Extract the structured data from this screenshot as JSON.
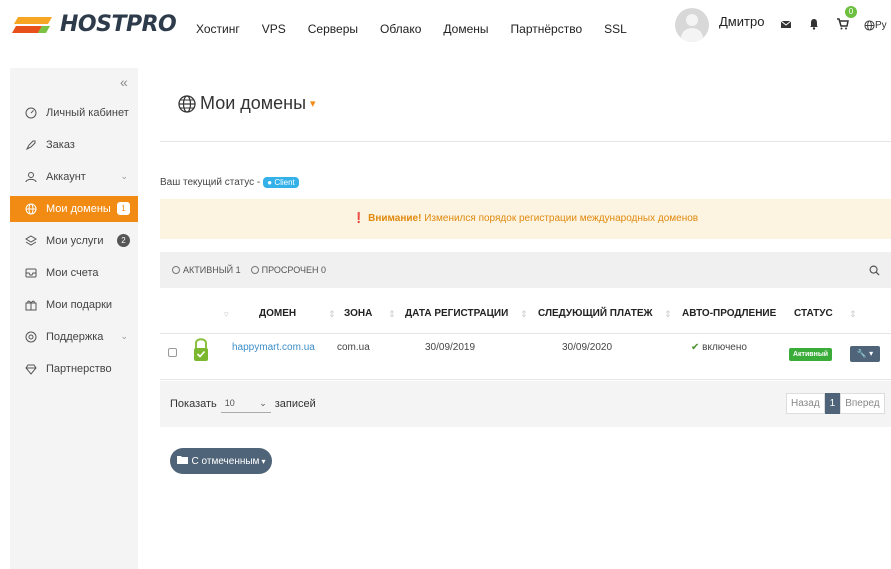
{
  "brand": {
    "name": "HOSTPRO",
    "accent": "#f28b13"
  },
  "header": {
    "nav": [
      "Хостинг",
      "VPS",
      "Серверы",
      "Облако",
      "Домены",
      "Партнёрство",
      "SSL"
    ],
    "user_name": "Дмитро",
    "cart_count": "0",
    "lang": "Ру"
  },
  "sidebar": {
    "collapse": "«",
    "items": [
      {
        "label": "Личный кабинет",
        "icon": "dashboard-icon"
      },
      {
        "label": "Заказ",
        "icon": "rocket-icon"
      },
      {
        "label": "Аккаунт",
        "icon": "user-icon"
      },
      {
        "label": "Мои домены",
        "icon": "globe-icon",
        "badge": "1",
        "active": true
      },
      {
        "label": "Мои услуги",
        "icon": "layers-icon",
        "badge": "2"
      },
      {
        "label": "Мои счета",
        "icon": "invoice-icon"
      },
      {
        "label": "Мои подарки",
        "icon": "gift-icon"
      },
      {
        "label": "Поддержка",
        "icon": "lifebuoy-icon"
      },
      {
        "label": "Партнерство",
        "icon": "diamond-icon"
      }
    ]
  },
  "main": {
    "title": "Мои домены",
    "status_label": "Ваш текущий статус -",
    "status_badge": "Client",
    "alert_strong": "Внимание!",
    "alert_text": "Изменился порядок регистрации международных доменов",
    "filters": {
      "active": "АКТИВНЫЙ 1",
      "expired": "ПРОСРОЧЕН 0"
    },
    "table": {
      "headers": {
        "domain": "ДОМЕН",
        "zone": "ЗОНА",
        "reg_date": "ДАТА РЕГИСТРАЦИИ",
        "next_payment": "СЛЕДУЮЩИЙ ПЛАТЕЖ",
        "autorenew": "АВТО-ПРОДЛЕНИЕ",
        "status": "СТАТУС"
      },
      "rows": [
        {
          "domain": "happymart.com.ua",
          "zone": "com.ua",
          "reg_date": "30/09/2019",
          "next_payment": "30/09/2020",
          "autorenew": "включено",
          "status": "Активный"
        }
      ]
    },
    "show": {
      "prefix": "Показать",
      "value": "10",
      "suffix": "записей"
    },
    "pager": {
      "prev": "Назад",
      "current": "1",
      "next": "Вперед"
    },
    "bulk_label": "С отмеченным"
  }
}
